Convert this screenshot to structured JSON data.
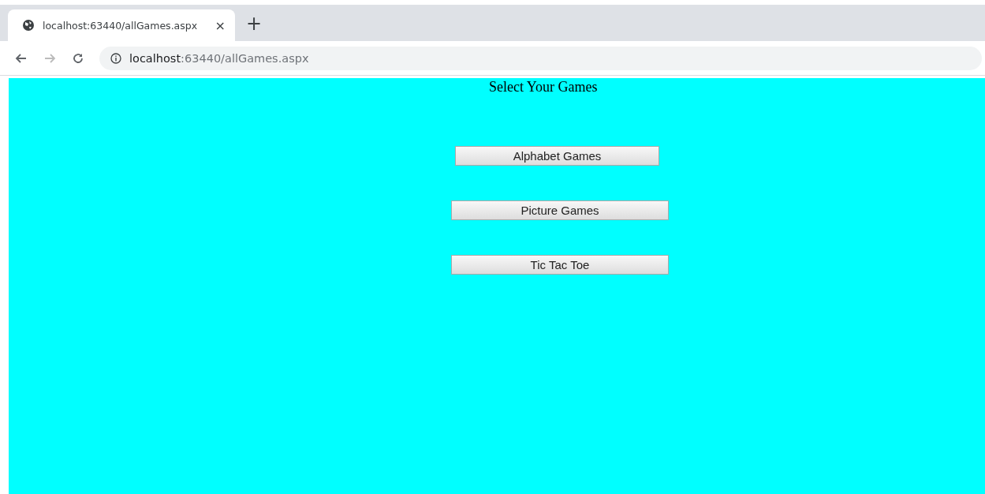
{
  "browser": {
    "tab": {
      "title": "localhost:63440/allGames.aspx",
      "close": "×",
      "new_tab": "+"
    },
    "address": {
      "host": "localhost",
      "rest": ":63440/allGames.aspx"
    },
    "back_disabled": false,
    "forward_disabled": true
  },
  "page": {
    "heading": "Select Your Games",
    "buttons": [
      {
        "label": "Alphabet Games"
      },
      {
        "label": "Picture Games"
      },
      {
        "label": "Tic Tac Toe"
      }
    ]
  }
}
